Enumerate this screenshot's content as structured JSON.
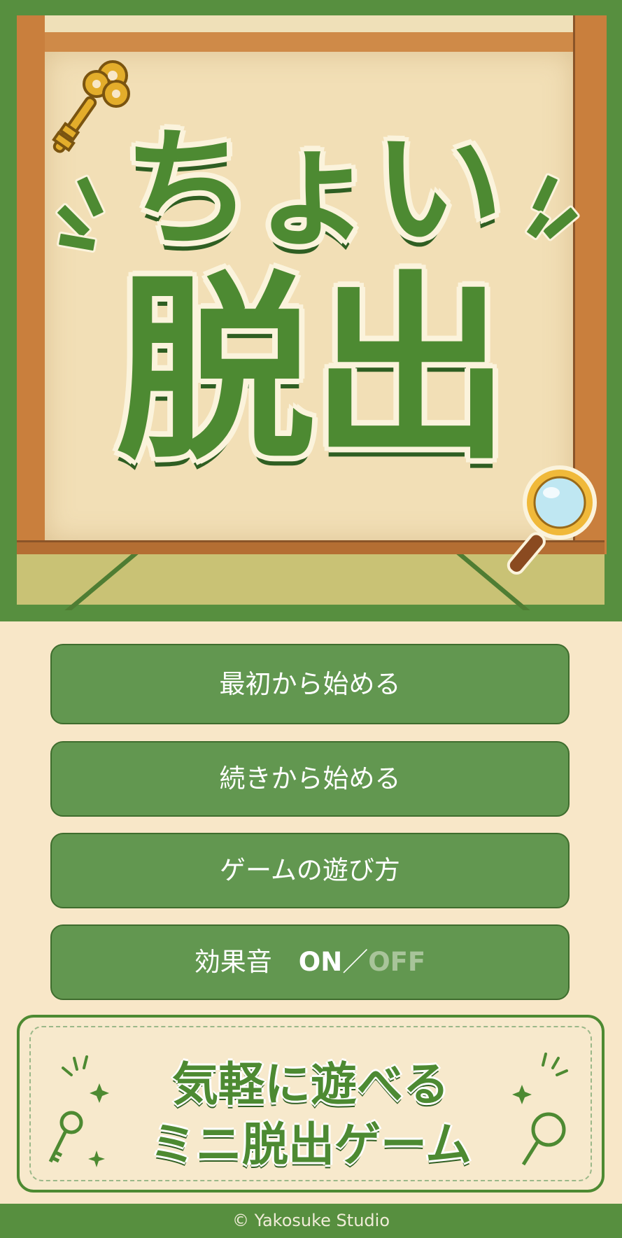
{
  "title": {
    "line1": "ちょい",
    "line2": "脱出"
  },
  "menu": {
    "new_game": "最初から始める",
    "continue": "続きから始める",
    "how_to_play": "ゲームの遊び方",
    "sound_label": "効果音",
    "sound_on": "ON",
    "sound_sep": "／",
    "sound_off": "OFF"
  },
  "banner": {
    "line1": "気軽に遊べる",
    "line2": "ミニ脱出ゲーム"
  },
  "footer": {
    "copyright": "© Yakosuke Studio"
  },
  "icons": [
    "key-icon",
    "magnifier-icon",
    "sparkle-icon"
  ],
  "colors": {
    "brand_green": "#578f3f",
    "button_green": "#629750",
    "background": "#f8e7c8"
  }
}
